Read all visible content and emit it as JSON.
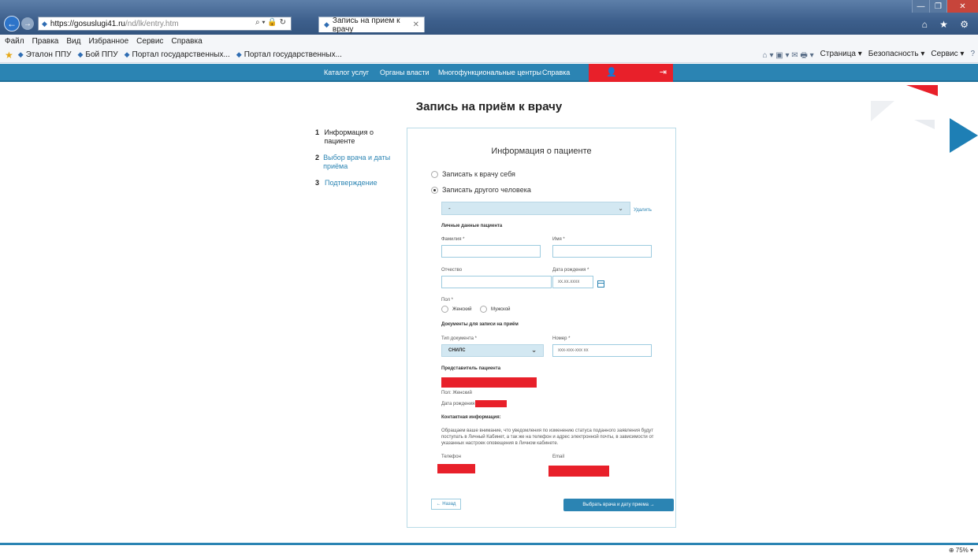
{
  "browser": {
    "url_host": "https://gosuslugi41.ru",
    "url_rest": "/nd/lk/entry.htm",
    "address_tools": "⌕ ▾ 🔒 ↻",
    "tab_title": "Запись на прием к врачу",
    "tab_close": "✕",
    "window_controls": [
      "—",
      "❐",
      "✕"
    ],
    "ie_icons": "⌂ ★ ⚙",
    "menu": [
      "Файл",
      "Правка",
      "Вид",
      "Избранное",
      "Сервис",
      "Справка"
    ],
    "favorites": [
      "Эталон ППУ",
      "Бой ППУ",
      "Портал государственных...",
      "Портал государственных..."
    ],
    "commands": [
      "Страница ▾",
      "Безопасность ▾",
      "Сервис ▾"
    ],
    "command_icons": "⌂ ▾ ▣ ▾ ✉ 🖶 ▾",
    "help_icon": "?",
    "zoom": "⊕ 75%  ▾",
    "icons": {
      "back": "←",
      "forward": "→",
      "favorites_star": "★",
      "site": "◆"
    }
  },
  "site_nav": {
    "links": [
      "Каталог услуг",
      "Органы власти",
      "Многофункциональные центры",
      "Справка"
    ],
    "user_icon": "👤",
    "logout_icon": "⇥"
  },
  "page": {
    "title": "Запись на приём к врачу",
    "steps": [
      {
        "num": "1",
        "label": "Информация о пациенте"
      },
      {
        "num": "2",
        "label": "Выбор врача и даты приёма"
      },
      {
        "num": "3",
        "label": "Подтверждение"
      }
    ]
  },
  "form": {
    "title": "Информация о пациенте",
    "radio_self": "Записать к врачу себя",
    "radio_other": "Записать другого человека",
    "person_select": "-",
    "delete_link": "Удалить",
    "personal_section": "Личные данные пациента",
    "surname_label": "Фамилия *",
    "name_label": "Имя *",
    "patronymic_label": "Отчество",
    "birthdate_label": "Дата рождения *",
    "birthdate_placeholder": "xx.xx.xxxx",
    "gender_label": "Пол *",
    "gender_female": "Женский",
    "gender_male": "Мужской",
    "docs_section": "Документы для записи на приём",
    "doc_type_label": "Тип документа *",
    "doc_type_value": "СНИЛС",
    "doc_number_label": "Номер *",
    "doc_number_placeholder": "xxx-xxx-xxx xx",
    "rep_section": "Представитель пациента",
    "rep_gender": "Пол: Женский",
    "rep_birthdate": "Дата рождения:",
    "contact_section": "Контактная информация:",
    "contact_note": "Обращаем ваше внимание, что уведомления по изменению статуса поданного заявления будут поступать в Личный Кабинет, а так же на телефон и адрес электронной почты, в зависимости от указанных настроек оповещения в Личном кабинете.",
    "phone_label": "Телефон",
    "email_label": "Email",
    "back_button": "← Назад",
    "next_button": "Выбрать врача и дату приема →",
    "chevron": "⌄"
  },
  "colors": {
    "accent": "#2b84b3",
    "redaction": "#e8202a",
    "panel_border": "#b9dbe7"
  }
}
